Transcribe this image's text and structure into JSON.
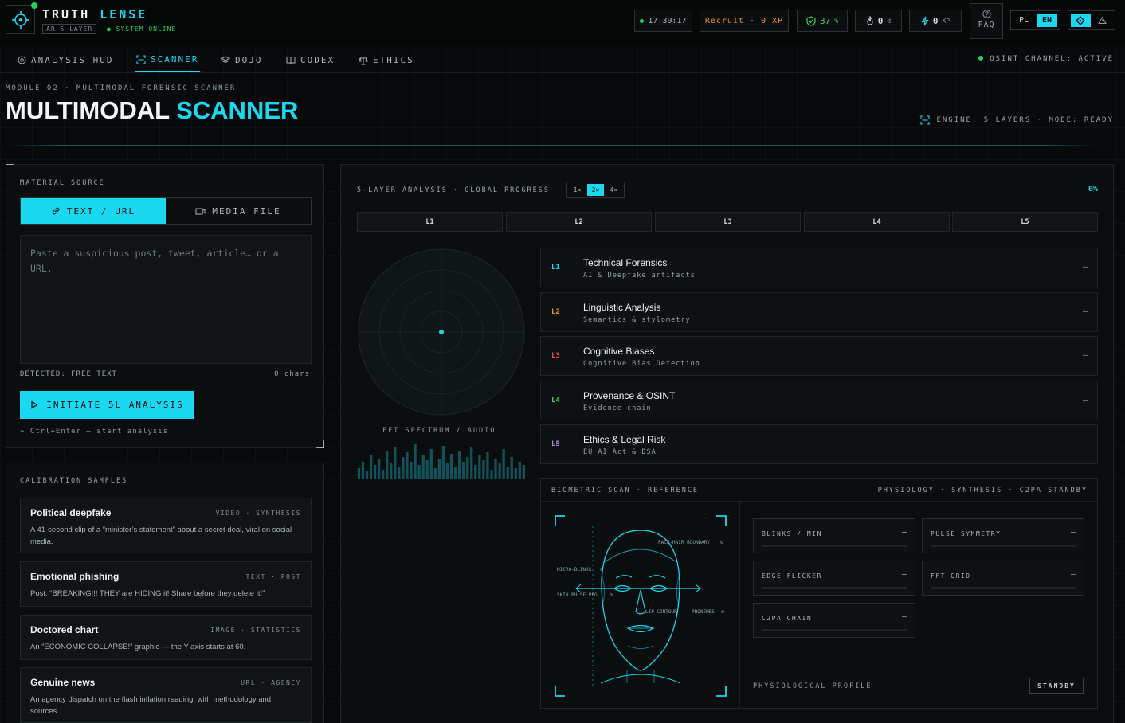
{
  "header": {
    "brand_part1": "TRUTH",
    "brand_part2": "LENSE",
    "version": "AR 5-LAYER",
    "system_status": "● SYSTEM ONLINE",
    "clock": "17:39:17",
    "rank": "Recruit · 0 XP",
    "shield_value": "37",
    "shield_unit": "%",
    "streak_value": "0",
    "streak_unit": "d",
    "xp_value": "0",
    "xp_unit": "XP",
    "faq_label": "FAQ",
    "lang": [
      "PL",
      "EN"
    ],
    "lang_active": "EN"
  },
  "nav": {
    "tabs": [
      {
        "label": "ANALYSIS HUD",
        "icon": "target-icon"
      },
      {
        "label": "SCANNER",
        "icon": "scan-icon"
      },
      {
        "label": "DOJO",
        "icon": "layers-icon"
      },
      {
        "label": "CODEX",
        "icon": "book-icon"
      },
      {
        "label": "ETHICS",
        "icon": "scales-icon"
      }
    ],
    "active_tab": "SCANNER",
    "osint_status": "OSINT CHANNEL: ACTIVE"
  },
  "page": {
    "breadcrumb": "MODULE 02 · MULTIMODAL FORENSIC SCANNER",
    "title_part1": "MULTIMODAL",
    "title_part2": "SCANNER",
    "engine_status": "ENGINE: 5 LAYERS · MODE: READY"
  },
  "source": {
    "title": "MATERIAL SOURCE",
    "tab_text": "TEXT / URL",
    "tab_media": "MEDIA FILE",
    "placeholder": "Paste a suspicious post, tweet, article… or a URL.",
    "detected": "DETECTED: FREE TEXT",
    "chars": "0 chars",
    "initiate_label": "INITIATE 5L ANALYSIS",
    "hint": "⌁ Ctrl+Enter — start analysis"
  },
  "calibration": {
    "title": "CALIBRATION SAMPLES",
    "samples": [
      {
        "title": "Political deepfake",
        "tags": "VIDEO · SYNTHESIS",
        "desc": "A 41-second clip of a “minister’s statement” about a secret deal, viral on social media."
      },
      {
        "title": "Emotional phishing",
        "tags": "TEXT · POST",
        "desc": "Post: “BREAKING!!! THEY are HIDING it! Share before they delete it!”"
      },
      {
        "title": "Doctored chart",
        "tags": "IMAGE · STATISTICS",
        "desc": "An “ECONOMIC COLLAPSE!” graphic — the Y-axis starts at 60."
      },
      {
        "title": "Genuine news",
        "tags": "URL · AGENCY",
        "desc": "An agency dispatch on the flash inflation reading, with methodology and sources."
      }
    ]
  },
  "analysis": {
    "progress_title": "5-LAYER ANALYSIS · GLOBAL PROGRESS",
    "speeds": [
      "1×",
      "2×",
      "4×"
    ],
    "speed_active": "2×",
    "progress_pct": "0%",
    "progress_value": 0,
    "layer_tabs": [
      "L1",
      "L2",
      "L3",
      "L4",
      "L5"
    ],
    "fft_label": "FFT SPECTRUM / AUDIO",
    "layers": [
      {
        "code": "L1",
        "title": "Technical Forensics",
        "sub": "AI & Deepfake artifacts",
        "value": "—",
        "color": "#19d8f0"
      },
      {
        "code": "L2",
        "title": "Linguistic Analysis",
        "sub": "Semantics & stylometry",
        "value": "—",
        "color": "#f0902a"
      },
      {
        "code": "L3",
        "title": "Cognitive Biases",
        "sub": "Cognitive Bias Detection",
        "value": "—",
        "color": "#f04a4a"
      },
      {
        "code": "L4",
        "title": "Provenance & OSINT",
        "sub": "Evidence chain",
        "value": "—",
        "color": "#3ed66a"
      },
      {
        "code": "L5",
        "title": "Ethics & Legal Risk",
        "sub": "EU AI Act & DSA",
        "value": "—",
        "color": "#a98cf0"
      }
    ]
  },
  "biometric": {
    "title": "BIOMETRIC SCAN · REFERENCE",
    "phys_status": "PHYSIOLOGY · SYNTHESIS · C2PA STANDBY",
    "face_labels": {
      "hair": "FACE-HAIR BOUNDARY",
      "blinks": "MICRO-BLINKS",
      "pulse": "SKIN PULSE PPG",
      "lip": "LIP CONTOUR",
      "phonemes": "PHONEMES"
    },
    "metrics": [
      {
        "name": "BLINKS / MIN",
        "value": "—"
      },
      {
        "name": "PULSE SYMMETRY",
        "value": "—"
      },
      {
        "name": "EDGE FLICKER",
        "value": "—"
      },
      {
        "name": "FFT GRID",
        "value": "—"
      },
      {
        "name": "C2PA CHAIN",
        "value": "—"
      }
    ],
    "profile_label": "PHYSIOLOGICAL PROFILE",
    "profile_status": "STANDBY"
  },
  "colors": {
    "accent": "#19d8f0",
    "online": "#1fd45a",
    "rank": "#f0902a",
    "shield": "#3ed66a"
  }
}
